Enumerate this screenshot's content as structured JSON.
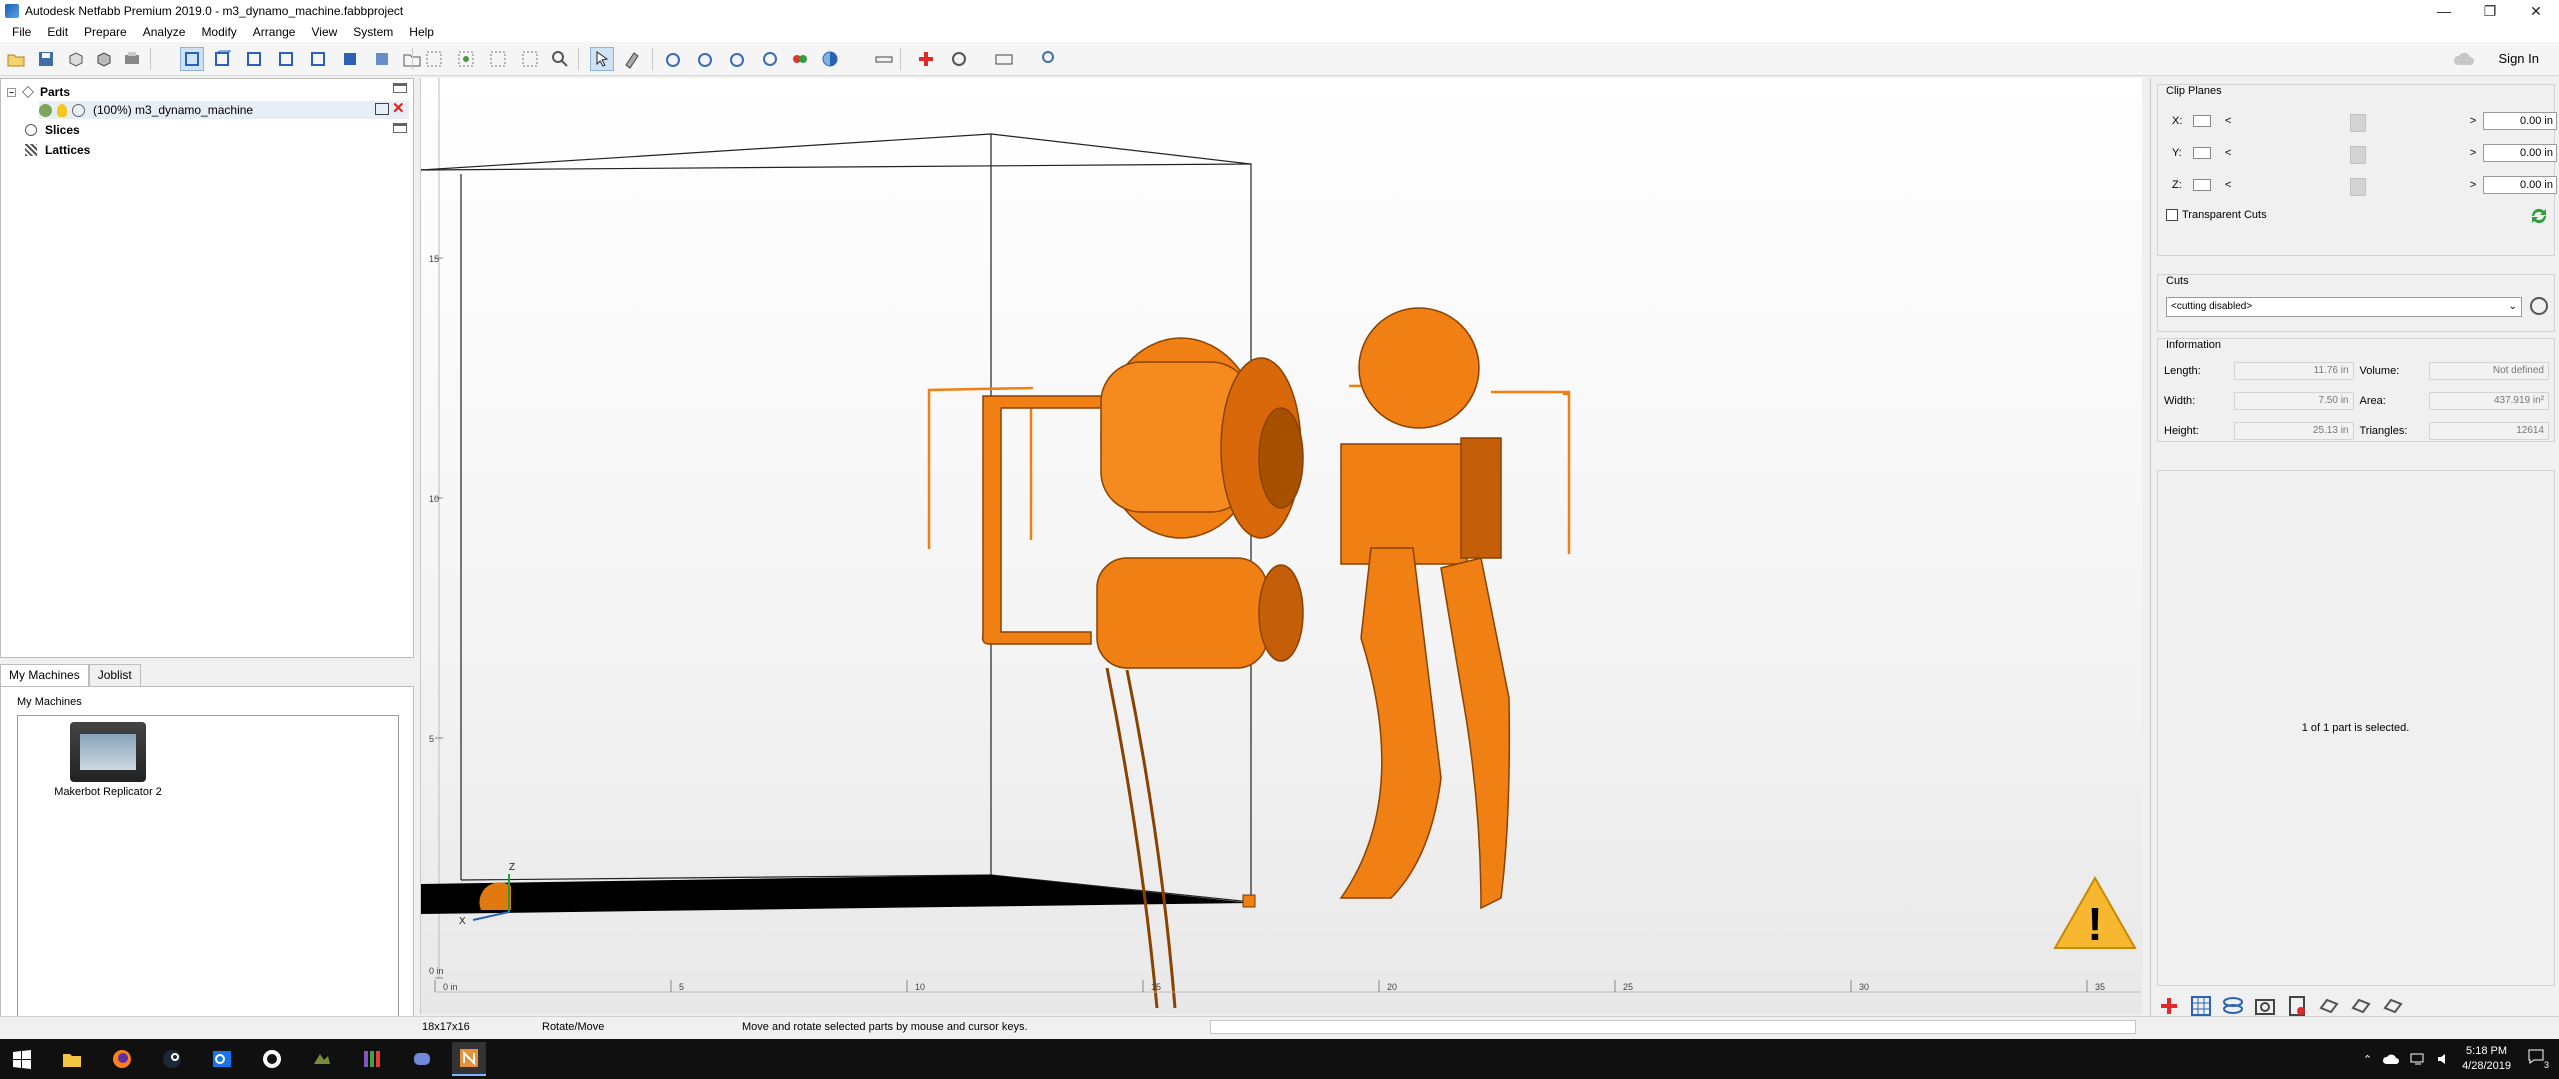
{
  "window": {
    "title": "Autodesk Netfabb Premium 2019.0 - m3_dynamo_machine.fabbproject",
    "minimize": "—",
    "restore": "❐",
    "close": "✕"
  },
  "menu": [
    "File",
    "Edit",
    "Prepare",
    "Analyze",
    "Modify",
    "Arrange",
    "View",
    "System",
    "Help"
  ],
  "toolbar": {
    "sign_in": "Sign In"
  },
  "tree": {
    "parts_label": "Parts",
    "part_name": "(100%) m3_dynamo_machine",
    "slices_label": "Slices",
    "lattices_label": "Lattices"
  },
  "machines": {
    "tabs": [
      "My Machines",
      "Joblist"
    ],
    "group_label": "My Machines",
    "machine_name": "Makerbot Replicator 2"
  },
  "viewport": {
    "ruler_h": [
      "0 in",
      "5",
      "10",
      "15",
      "20",
      "25",
      "30",
      "35"
    ],
    "ruler_v": [
      "15",
      "10",
      "5",
      "0 in"
    ],
    "axis_x": "X",
    "axis_z": "Z",
    "warning_symbol": "!"
  },
  "clip_planes": {
    "title": "Clip Planes",
    "rows": [
      {
        "axis": "X:",
        "value": "0.00 in"
      },
      {
        "axis": "Y:",
        "value": "0.00 in"
      },
      {
        "axis": "Z:",
        "value": "0.00 in"
      }
    ],
    "transparent_cuts": "Transparent Cuts"
  },
  "cuts": {
    "title": "Cuts",
    "selected": "<cutting disabled>"
  },
  "information": {
    "title": "Information",
    "length_label": "Length:",
    "length": "11.76 in",
    "volume_label": "Volume:",
    "volume": "Not defined",
    "width_label": "Width:",
    "width": "7.50 in",
    "area_label": "Area:",
    "area": "437.919 in²",
    "height_label": "Height:",
    "height": "25.13 in",
    "triangles_label": "Triangles:",
    "triangles": "12614"
  },
  "selection_message": "1 of 1 part is selected.",
  "status": {
    "dimensions": "18x17x16",
    "mode": "Rotate/Move",
    "hint": "Move and rotate selected parts by mouse and cursor keys."
  },
  "taskbar": {
    "time": "5:18 PM",
    "date": "4/28/2019",
    "notification_count": "3"
  },
  "colors": {
    "part": "#f07f14",
    "part_dark": "#a84e00",
    "warning": "#f7b731",
    "accent": "#1a73e8"
  }
}
